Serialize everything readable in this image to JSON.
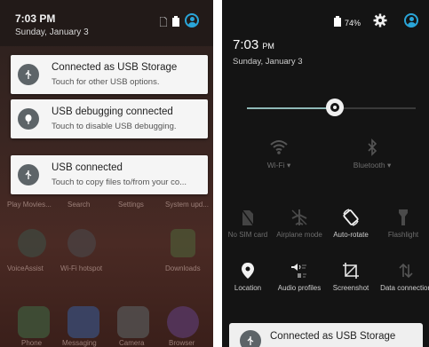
{
  "left_screen": {
    "status": {
      "time": "7:03 PM",
      "date": "Sunday, January 3"
    },
    "notifications": [
      {
        "title": "Connected as USB Storage",
        "text": "Touch for other USB options."
      },
      {
        "title": "USB debugging connected",
        "text": "Touch to disable USB debugging."
      },
      {
        "title": "USB connected",
        "text": "Touch to copy files to/from your co..."
      }
    ],
    "drawer_labels": [
      "Play Movies...",
      "Search",
      "Settings",
      "System upd..."
    ],
    "home_labels": [
      "VoiceAssist",
      "Wi-Fi hotspot",
      "Downloads"
    ],
    "dock_labels": [
      "Phone",
      "Messaging",
      "Camera",
      "Browser"
    ]
  },
  "right_screen": {
    "status": {
      "battery": "74%"
    },
    "time": "7:03",
    "time_suffix": "PM",
    "date": "Sunday, January 3",
    "brightness_level": 0.52,
    "tiles_large": [
      {
        "label": "Wi-Fi",
        "icon": "wifi-icon"
      },
      {
        "label": "Bluetooth",
        "icon": "bluetooth-icon"
      }
    ],
    "tiles_row1": [
      {
        "label": "No SIM card",
        "icon": "no-sim-icon"
      },
      {
        "label": "Airplane mode",
        "icon": "airplane-icon"
      },
      {
        "label": "Auto-rotate",
        "icon": "auto-rotate-icon"
      },
      {
        "label": "Flashlight",
        "icon": "flashlight-icon"
      }
    ],
    "tiles_row2": [
      {
        "label": "Location",
        "icon": "location-icon"
      },
      {
        "label": "Audio profiles",
        "icon": "audio-profiles-icon"
      },
      {
        "label": "Screenshot",
        "icon": "screenshot-icon"
      },
      {
        "label": "Data connection",
        "icon": "data-connection-icon"
      }
    ],
    "notification": {
      "title": "Connected as USB Storage"
    }
  }
}
